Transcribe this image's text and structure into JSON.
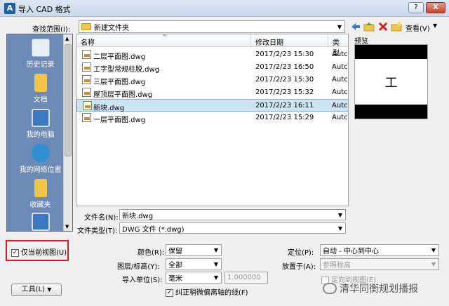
{
  "window": {
    "title": "导入 CAD 格式",
    "help_label": "?",
    "close_label": "X"
  },
  "toolbar": {
    "lookin_label": "查找范围(I):",
    "lookin_value": "新建文件夹",
    "views_label": "查看(V)",
    "tools_menu_label": "工具(L)"
  },
  "sidebar": {
    "items": [
      {
        "label": "历史记录",
        "icon": "history-icon"
      },
      {
        "label": "文档",
        "icon": "documents-icon"
      },
      {
        "label": "我的电脑",
        "icon": "my-computer-icon"
      },
      {
        "label": "我的网络位置",
        "icon": "network-icon"
      },
      {
        "label": "收藏夹",
        "icon": "favorites-icon"
      },
      {
        "label": "",
        "icon": "desktop-icon"
      }
    ]
  },
  "filelist": {
    "columns": [
      "名称",
      "修改日期",
      "类型"
    ],
    "rows": [
      {
        "name": "二层平面图.dwg",
        "date": "2017/2/23 15:30",
        "type": "Autc"
      },
      {
        "name": "工字型常规柱脱.dwg",
        "date": "2017/2/23 16:50",
        "type": "Autc"
      },
      {
        "name": "三层平面图.dwg",
        "date": "2017/2/23 15:30",
        "type": "Autc"
      },
      {
        "name": "屋顶层平面图.dwg",
        "date": "2017/2/23 15:32",
        "type": "Autc"
      },
      {
        "name": "新块.dwg",
        "date": "2017/2/23 16:11",
        "type": "Autc",
        "selected": true
      },
      {
        "name": "一层平面图.dwg",
        "date": "2017/2/23 15:29",
        "type": "Autc"
      }
    ]
  },
  "preview": {
    "label": "预览",
    "symbol": "工"
  },
  "filename": {
    "label": "文件名(N):",
    "value": "新块.dwg"
  },
  "filetype": {
    "label": "文件类型(T):",
    "value": "DWG 文件 (*.dwg)"
  },
  "options": {
    "current_view_only": {
      "label": "仅当前视图(U)",
      "checked": true
    },
    "colors": {
      "label": "颜色(R):",
      "value": "保留"
    },
    "layers": {
      "label": "图层/标高(Y):",
      "value": "全部"
    },
    "import_units": {
      "label": "导入单位(S):",
      "value": "毫米",
      "scale": "1.000000"
    },
    "correct_lines": {
      "label": "纠正稍微偏离轴的线(F)",
      "checked": true
    },
    "positioning": {
      "label": "定位(P):",
      "value": "自动 - 中心到中心"
    },
    "place_at": {
      "label": "放置于(A):",
      "value": "参照标高"
    },
    "orient_to_view": {
      "label": "定向到视图(E)"
    }
  },
  "watermark": {
    "text": "清华同衡规划播报"
  }
}
